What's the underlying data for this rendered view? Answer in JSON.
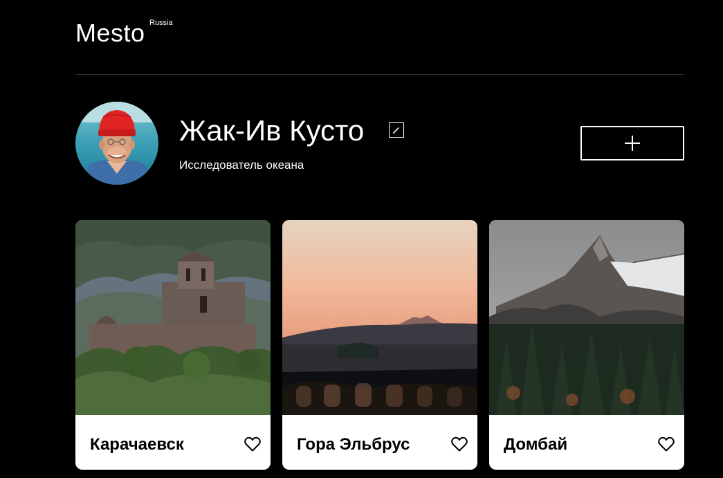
{
  "header": {
    "logo_text": "Mesto",
    "logo_sup": "Russia"
  },
  "profile": {
    "name": "Жак-Ив Кусто",
    "about": "Исследователь океана",
    "avatar_icon": "user-avatar",
    "edit_icon": "pencil-icon",
    "add_icon": "plus-icon"
  },
  "cards": [
    {
      "title": "Карачаевск",
      "like_icon": "heart-icon"
    },
    {
      "title": "Гора Эльбрус",
      "like_icon": "heart-icon"
    },
    {
      "title": "Домбай",
      "like_icon": "heart-icon"
    }
  ],
  "colors": {
    "background": "#000000",
    "text": "#ffffff",
    "card_bg": "#ffffff",
    "card_text": "#000000",
    "divider": "#545454"
  }
}
